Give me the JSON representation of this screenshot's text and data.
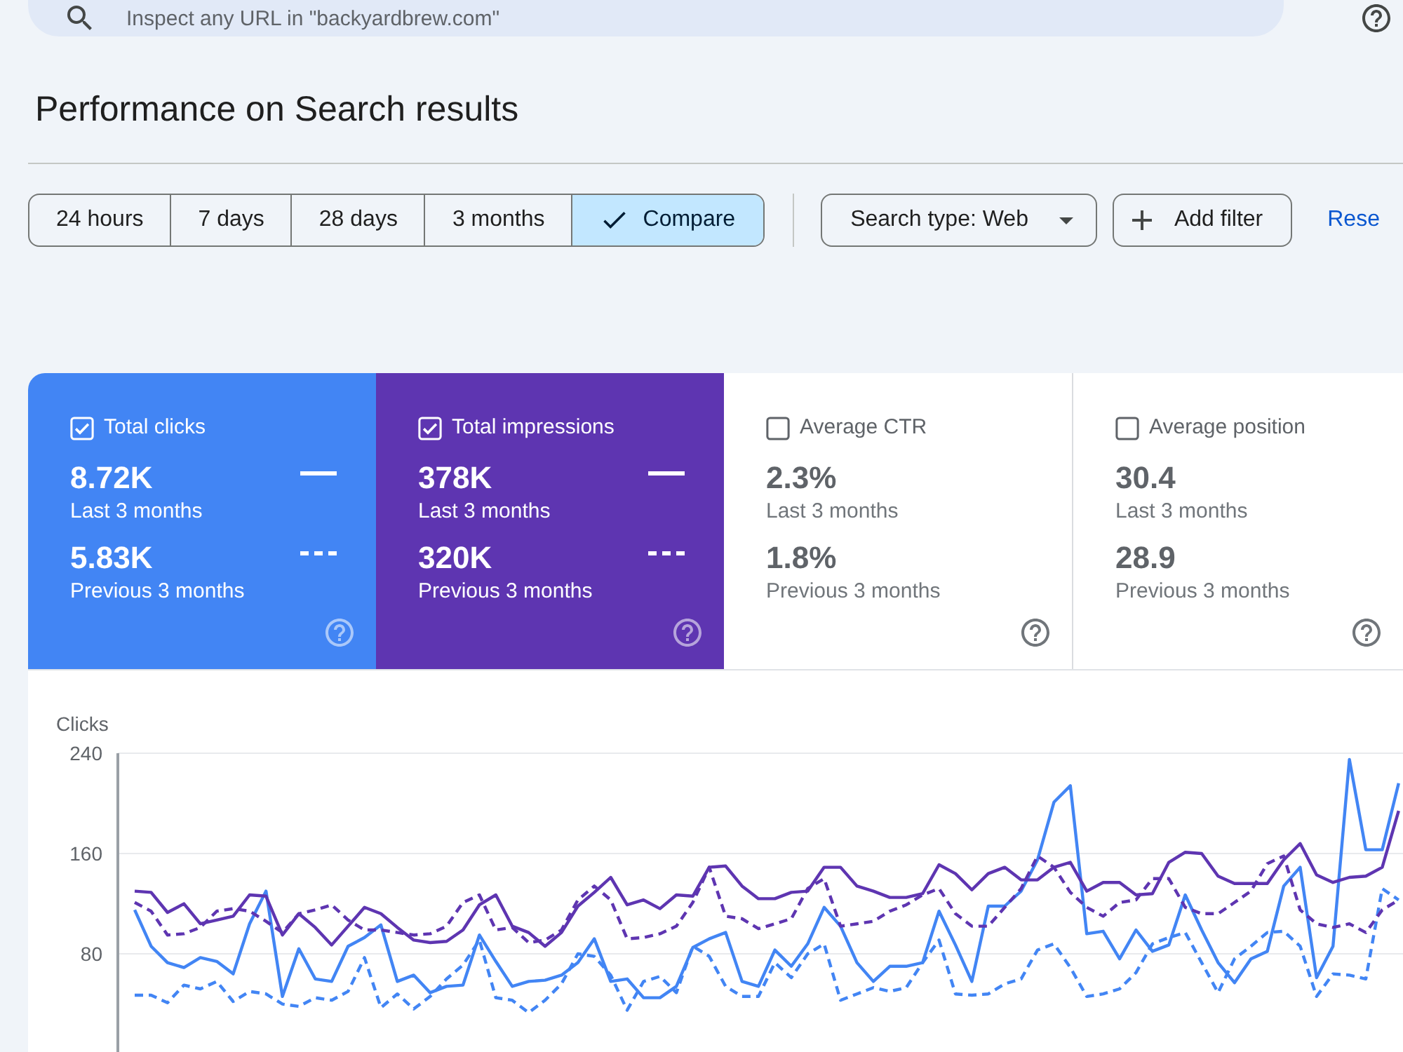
{
  "search": {
    "placeholder": "Inspect any URL in \"backyardbrew.com\""
  },
  "page_title": "Performance on Search results",
  "date_ranges": [
    {
      "label": "24 hours",
      "selected": false
    },
    {
      "label": "7 days",
      "selected": false
    },
    {
      "label": "28 days",
      "selected": false
    },
    {
      "label": "3 months",
      "selected": false
    },
    {
      "label": "Compare",
      "selected": true
    }
  ],
  "filters": [
    {
      "kind": "dropdown",
      "label": "Search type: Web"
    },
    {
      "kind": "add",
      "label": "Add filter"
    }
  ],
  "reset_link": "Rese",
  "metrics": [
    {
      "label": "Total clicks",
      "checked": true,
      "color": "#4285f4",
      "current": {
        "value": "8.72K",
        "period": "Last 3 months"
      },
      "previous": {
        "value": "5.83K",
        "period": "Previous 3 months"
      }
    },
    {
      "label": "Total impressions",
      "checked": true,
      "color": "#5e35b1",
      "current": {
        "value": "378K",
        "period": "Last 3 months"
      },
      "previous": {
        "value": "320K",
        "period": "Previous 3 months"
      }
    },
    {
      "label": "Average CTR",
      "checked": false,
      "current": {
        "value": "2.3%",
        "period": "Last 3 months"
      },
      "previous": {
        "value": "1.8%",
        "period": "Previous 3 months"
      }
    },
    {
      "label": "Average position",
      "checked": false,
      "current": {
        "value": "30.4",
        "period": "Last 3 months"
      },
      "previous": {
        "value": "28.9",
        "period": "Previous 3 months"
      }
    }
  ],
  "chart": {
    "chart_data": {
      "type": "line",
      "ylabel": "Clicks",
      "ylim": [
        0,
        240
      ],
      "yticks": [
        80,
        160,
        240
      ],
      "series": [
        {
          "color": "#4285f4",
          "line_style": "solid",
          "values": [
            115,
            86,
            73,
            69,
            77,
            74,
            64,
            104,
            130,
            46,
            84,
            60,
            58,
            86,
            93,
            103,
            58,
            63,
            49,
            54,
            55,
            95,
            74,
            54,
            58,
            59,
            63,
            73,
            92,
            58,
            60,
            45,
            45,
            54,
            85,
            92,
            97,
            58,
            54,
            83,
            70,
            88,
            117,
            102,
            73,
            58,
            70,
            70,
            73,
            114,
            87,
            58,
            118,
            118,
            130,
            155,
            201,
            214,
            96,
            98,
            76,
            99,
            82,
            87,
            127,
            99,
            73,
            57,
            76,
            82,
            134,
            149,
            61,
            86,
            235,
            163,
            163,
            216
          ]
        },
        {
          "color": "#4285f4",
          "line_style": "dashed",
          "values": [
            47,
            47,
            41,
            55,
            52,
            58,
            42,
            50,
            48,
            40,
            38,
            45,
            43,
            50,
            77,
            37,
            48,
            36,
            46,
            60,
            71,
            91,
            45,
            43,
            33,
            43,
            56,
            80,
            78,
            63,
            35,
            58,
            62,
            49,
            86,
            78,
            54,
            46,
            46,
            73,
            61,
            80,
            88,
            43,
            48,
            53,
            50,
            53,
            73,
            91,
            48,
            47,
            48,
            56,
            60,
            83,
            88,
            69,
            46,
            48,
            52,
            65,
            88,
            93,
            97,
            73,
            49,
            76,
            86,
            97,
            98,
            86,
            46,
            64,
            63,
            60,
            132,
            123
          ]
        },
        {
          "color": "#5e35b1",
          "line_style": "solid",
          "values": [
            130,
            129,
            113,
            120,
            104,
            107,
            110,
            127,
            126,
            95,
            112,
            101,
            87,
            102,
            117,
            112,
            101,
            91,
            89,
            90,
            99,
            119,
            127,
            102,
            97,
            86,
            97,
            118,
            129,
            141,
            119,
            123,
            116,
            127,
            126,
            149,
            150,
            134,
            124,
            124,
            129,
            130,
            149,
            149,
            134,
            130,
            125,
            125,
            128,
            151,
            144,
            131,
            144,
            149,
            139,
            139,
            149,
            153,
            130,
            137,
            137,
            127,
            128,
            153,
            161,
            160,
            142,
            136,
            136,
            136,
            155,
            168,
            143,
            137,
            141,
            142,
            149,
            194
          ]
        },
        {
          "color": "#5e35b1",
          "line_style": "dashed",
          "values": [
            121,
            114,
            95,
            96,
            101,
            114,
            116,
            114,
            106,
            97,
            112,
            115,
            119,
            107,
            99,
            99,
            97,
            95,
            96,
            102,
            121,
            127,
            99,
            101,
            89,
            91,
            99,
            123,
            134,
            123,
            92,
            93,
            96,
            102,
            121,
            149,
            110,
            108,
            100,
            104,
            108,
            132,
            140,
            102,
            104,
            106,
            114,
            119,
            127,
            132,
            112,
            102,
            102,
            117,
            132,
            158,
            149,
            129,
            117,
            110,
            121,
            123,
            140,
            140,
            117,
            112,
            112,
            121,
            130,
            152,
            158,
            115,
            104,
            101,
            104,
            97,
            115,
            123
          ]
        }
      ]
    }
  }
}
